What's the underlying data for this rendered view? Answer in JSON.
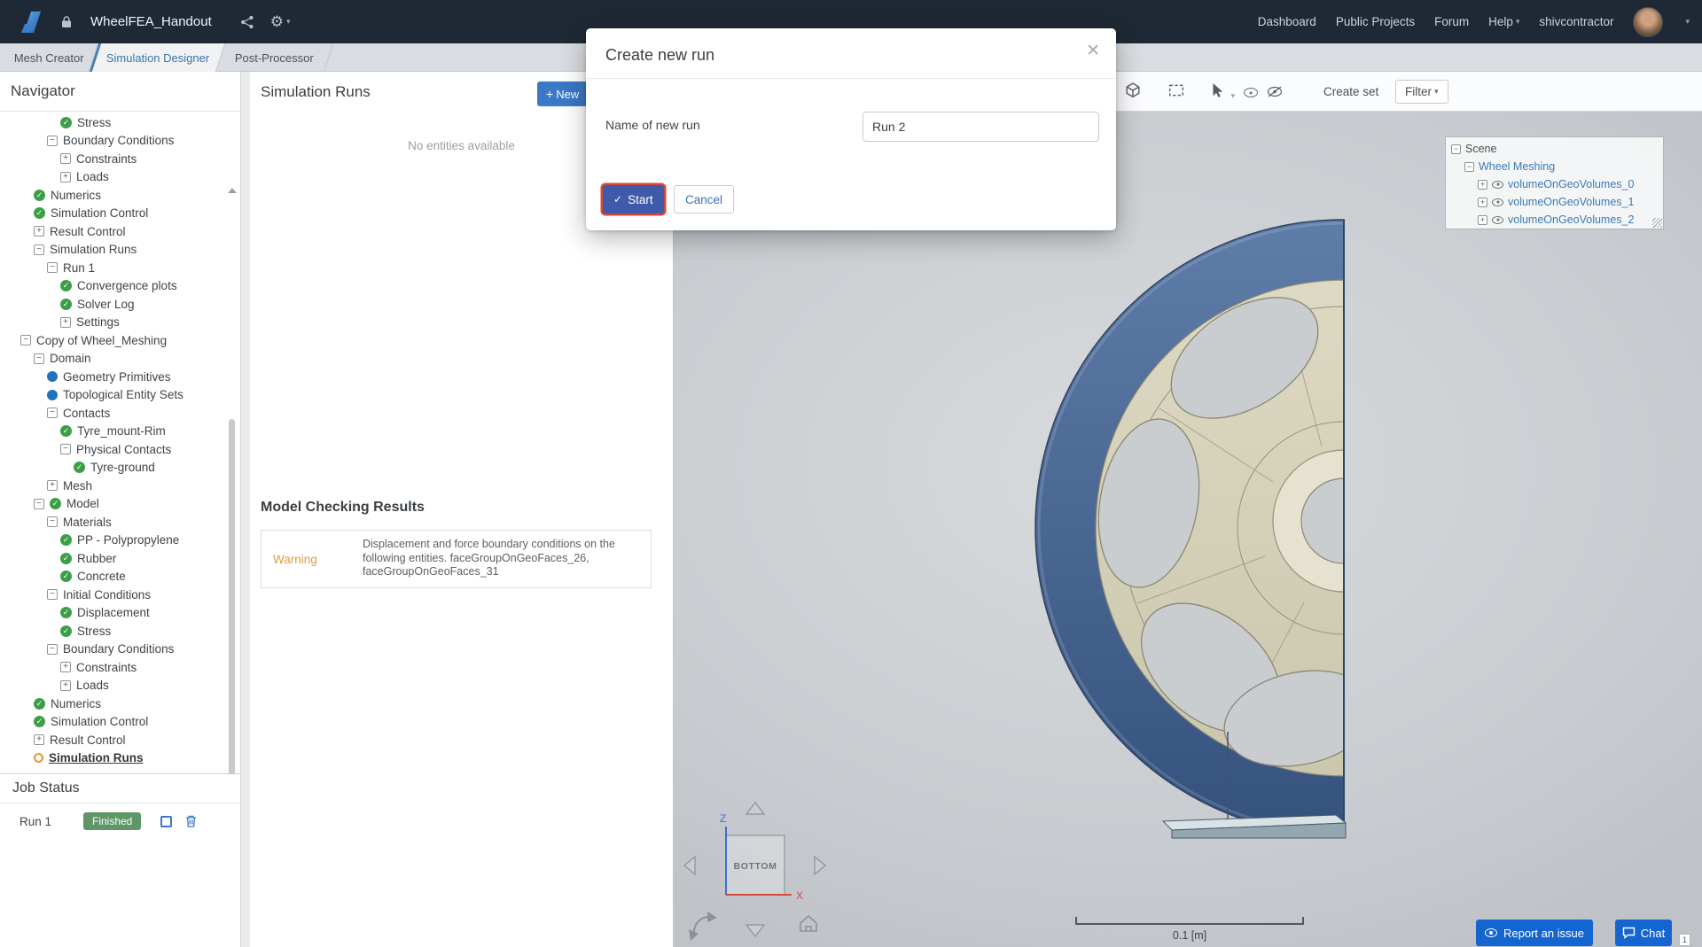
{
  "colors": {
    "topbar_bg": "#1f2935",
    "accent_blue": "#3b78c7",
    "success_green": "#3c9e47",
    "badge_green": "#5f9668",
    "warning_orange": "#e09d40",
    "start_button": "#3f5aa9",
    "start_ring_red": "#d8463a",
    "viewport_link_blue": "#3c7ab8",
    "tire_blue": "#47628f",
    "rim_beige": "#d6d2ba"
  },
  "topbar": {
    "title": "WheelFEA_Handout",
    "menu": {
      "dashboard": "Dashboard",
      "public_projects": "Public Projects",
      "forum": "Forum",
      "help": "Help",
      "user": "shivcontractor"
    }
  },
  "tabs": [
    {
      "label": "Mesh Creator",
      "active": false
    },
    {
      "label": "Simulation Designer",
      "active": true
    },
    {
      "label": "Post-Processor",
      "active": false
    }
  ],
  "navigator": {
    "title": "Navigator",
    "items": [
      {
        "d": 4,
        "i": "check",
        "t": "Stress"
      },
      {
        "d": 3,
        "e": "minus",
        "t": "Boundary Conditions"
      },
      {
        "d": 4,
        "e": "plus",
        "t": "Constraints"
      },
      {
        "d": 4,
        "e": "plus",
        "t": "Loads"
      },
      {
        "d": 2,
        "i": "check",
        "t": "Numerics"
      },
      {
        "d": 2,
        "i": "check",
        "t": "Simulation Control"
      },
      {
        "d": 2,
        "e": "plus",
        "t": "Result Control"
      },
      {
        "d": 2,
        "e": "minus",
        "t": "Simulation Runs"
      },
      {
        "d": 3,
        "e": "minus",
        "t": "Run 1"
      },
      {
        "d": 4,
        "i": "check",
        "t": "Convergence plots"
      },
      {
        "d": 4,
        "i": "check",
        "t": "Solver Log"
      },
      {
        "d": 4,
        "e": "plus",
        "t": "Settings"
      },
      {
        "d": 1,
        "e": "minus",
        "t": "Copy of Wheel_Meshing"
      },
      {
        "d": 2,
        "e": "minus",
        "t": "Domain"
      },
      {
        "d": 3,
        "i": "dot",
        "t": "Geometry Primitives"
      },
      {
        "d": 3,
        "i": "dot",
        "t": "Topological Entity Sets"
      },
      {
        "d": 3,
        "e": "minus",
        "t": "Contacts"
      },
      {
        "d": 4,
        "i": "check",
        "t": "Tyre_mount-Rim"
      },
      {
        "d": 4,
        "e": "minus",
        "t": "Physical Contacts"
      },
      {
        "d": 5,
        "i": "check",
        "t": "Tyre-ground"
      },
      {
        "d": 3,
        "e": "plus",
        "t": "Mesh"
      },
      {
        "d": 2,
        "e": "minus",
        "i": "check",
        "t": "Model"
      },
      {
        "d": 3,
        "e": "minus",
        "t": "Materials"
      },
      {
        "d": 4,
        "i": "check",
        "t": "PP - Polypropylene"
      },
      {
        "d": 4,
        "i": "check",
        "t": "Rubber"
      },
      {
        "d": 4,
        "i": "check",
        "t": "Concrete"
      },
      {
        "d": 3,
        "e": "minus",
        "t": "Initial Conditions"
      },
      {
        "d": 4,
        "i": "check",
        "t": "Displacement"
      },
      {
        "d": 4,
        "i": "check",
        "t": "Stress"
      },
      {
        "d": 3,
        "e": "minus",
        "t": "Boundary Conditions"
      },
      {
        "d": 4,
        "e": "plus",
        "t": "Constraints"
      },
      {
        "d": 4,
        "e": "plus",
        "t": "Loads"
      },
      {
        "d": 2,
        "i": "check",
        "t": "Numerics"
      },
      {
        "d": 2,
        "i": "check",
        "t": "Simulation Control"
      },
      {
        "d": 2,
        "e": "plus",
        "t": "Result Control"
      },
      {
        "d": 2,
        "i": "ring",
        "t": "Simulation Runs",
        "b": true
      }
    ]
  },
  "job_status": {
    "title": "Job Status",
    "run": "Run 1",
    "state": "Finished"
  },
  "runs_panel": {
    "title": "Simulation Runs",
    "new_button": "New",
    "empty": "No entities available",
    "model_checking": {
      "title": "Model Checking Results",
      "level": "Warning",
      "message": "Displacement and force boundary conditions on the following entities. faceGroupOnGeoFaces_26, faceGroupOnGeoFaces_31"
    }
  },
  "modal": {
    "title": "Create new run",
    "field_label": "Name of new run",
    "value": "Run 2",
    "start": "Start",
    "cancel": "Cancel"
  },
  "viewport": {
    "create_set": "Create set",
    "filter": "Filter",
    "scene": {
      "rows": [
        {
          "d": 0,
          "e": "minus",
          "t": "Scene",
          "c": "dark",
          "eye": false
        },
        {
          "d": 1,
          "e": "minus",
          "t": "Wheel Meshing",
          "c": "blue",
          "eye": false
        },
        {
          "d": 2,
          "e": "plus",
          "t": "volumeOnGeoVolumes_0",
          "c": "blue",
          "eye": true
        },
        {
          "d": 2,
          "e": "plus",
          "t": "volumeOnGeoVolumes_1",
          "c": "blue",
          "eye": true
        },
        {
          "d": 2,
          "e": "plus",
          "t": "volumeOnGeoVolumes_2",
          "c": "blue",
          "eye": true
        }
      ]
    },
    "cube": "BOTTOM",
    "axis_z": "Z",
    "axis_x": "X",
    "scale": "0.1 [m]"
  },
  "footer": {
    "report": "Report an issue",
    "chat": "Chat",
    "badge": "1"
  }
}
